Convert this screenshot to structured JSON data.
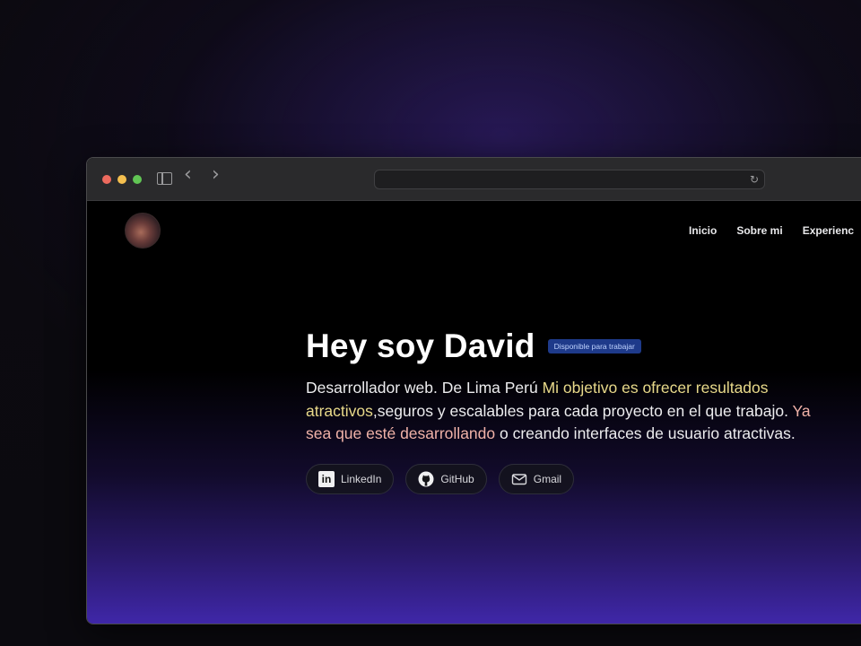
{
  "browser": {
    "nav_back_glyph": "‹",
    "nav_forward_glyph": "›",
    "reload_glyph": "↻",
    "icons": {
      "sidebar": "sidebar-icon",
      "back": "chevron-left-icon",
      "forward": "chevron-right-icon",
      "reload": "reload-icon"
    }
  },
  "site": {
    "nav": [
      {
        "label": "Inicio"
      },
      {
        "label": "Sobre mi"
      },
      {
        "label": "Experienc"
      }
    ],
    "hero": {
      "title": "Hey soy David",
      "badge": "Disponible para trabajar",
      "desc_1": "Desarrollador web. De Lima Perú ",
      "desc_hl_1": "Mi objetivo es ofrecer resultados atractivos",
      "desc_2": ",seguros y escalables para cada proyecto en el que trabajo. ",
      "desc_hl_2": "Ya sea que esté desarrollando",
      "desc_3": " o creando interfaces de usuario atractivas."
    },
    "links": [
      {
        "label": "LinkedIn",
        "icon": "linkedin-icon"
      },
      {
        "label": "GitHub",
        "icon": "github-icon"
      },
      {
        "label": "Gmail",
        "icon": "mail-icon"
      }
    ]
  },
  "colors": {
    "highlight_yellow": "#e8d98a",
    "highlight_pink": "#f0b2a8",
    "badge_bg": "#1e3a8a",
    "gradient_purple": "#3f27a8"
  }
}
